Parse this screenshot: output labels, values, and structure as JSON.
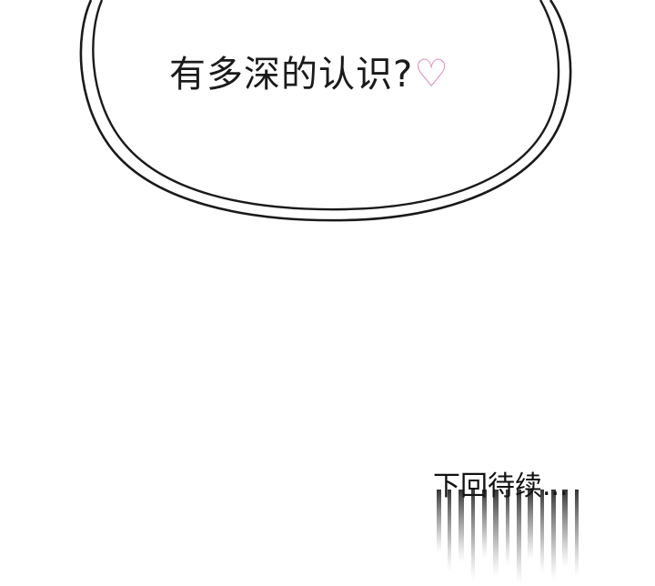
{
  "dialogue": {
    "text": "有多深的认识?",
    "heart_glyph": "♡",
    "heart_color": "#d98fc0"
  },
  "ending": {
    "text": "下回待续..."
  },
  "colors": {
    "background": "#ffffff",
    "bubble_stroke": "#1a1a1a",
    "text": "#1a1a1a"
  }
}
